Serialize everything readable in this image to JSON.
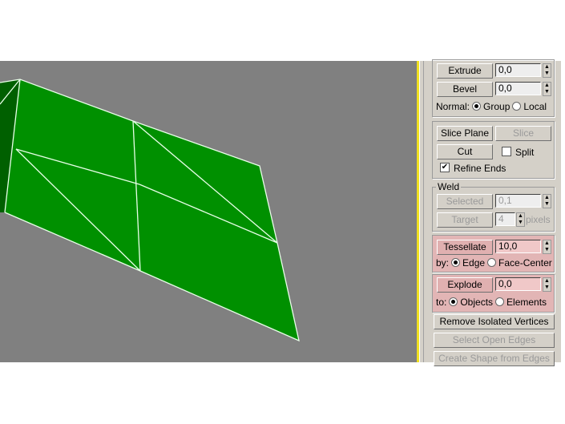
{
  "colors": {
    "viewport": "#808080",
    "face": "#009000",
    "face_dark": "#006000",
    "edge": "#e8ffe8",
    "highlight": "#e2b5b5"
  },
  "panel": {
    "extrude": {
      "label": "Extrude",
      "value": "0,0"
    },
    "bevel": {
      "label": "Bevel",
      "value": "0,0"
    },
    "normal": {
      "label": "Normal:",
      "opt1": "Group",
      "opt2": "Local"
    },
    "slice_plane": "Slice Plane",
    "slice": "Slice",
    "cut": "Cut",
    "split": "Split",
    "refine_ends": "Refine Ends",
    "weld": {
      "title": "Weld",
      "selected": "Selected",
      "selected_value": "0,1",
      "target": "Target",
      "target_value": "4",
      "pixels": "pixels"
    },
    "tessellate": {
      "label": "Tessellate",
      "value": "10,0",
      "by": "by:",
      "opt1": "Edge",
      "opt2": "Face-Center"
    },
    "explode": {
      "label": "Explode",
      "value": "0,0",
      "to": "to:",
      "opt1": "Objects",
      "opt2": "Elements"
    },
    "remove_isolated": "Remove Isolated Vertices",
    "select_open_edges": "Select Open Edges",
    "create_shape": "Create Shape from Edges"
  }
}
